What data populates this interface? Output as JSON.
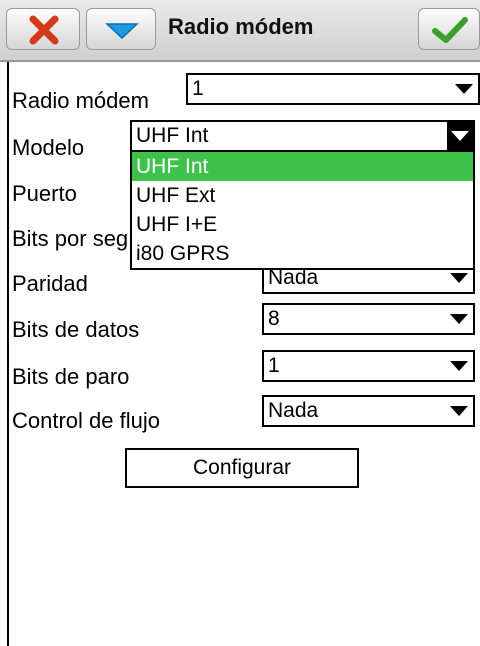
{
  "titlebar": {
    "title": "Radio módem"
  },
  "fields": [
    {
      "label": "Radio módem",
      "value": "1"
    },
    {
      "label": "Modelo",
      "value": "UHF Int"
    },
    {
      "label": "Puerto"
    },
    {
      "label": "Bits por seg"
    },
    {
      "label": "Paridad",
      "value": "Nada"
    },
    {
      "label": "Bits de datos",
      "value": "8"
    },
    {
      "label": "Bits de paro",
      "value": "1"
    },
    {
      "label": "Control de flujo",
      "value": "Nada"
    }
  ],
  "dropdown": {
    "options": [
      "UHF Int",
      "UHF Ext",
      "UHF I+E",
      "i80 GPRS"
    ],
    "selected": "UHF Int"
  },
  "configure_button": "Configurar",
  "colors": {
    "selection": "#3fc24a",
    "close_x": "#d43a1a",
    "ok_check": "#3aa02a",
    "dropdown_arrow": "#1e9be0"
  }
}
